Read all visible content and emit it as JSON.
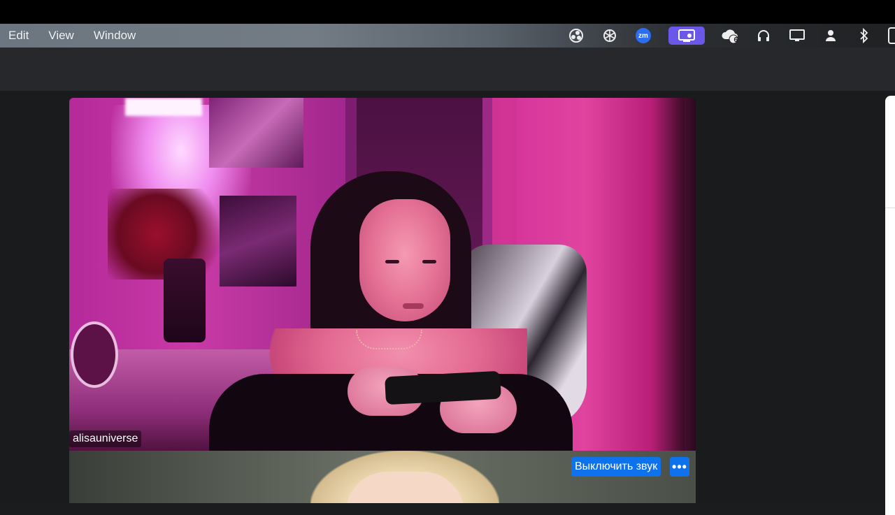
{
  "menubar": {
    "items": [
      {
        "label": "Edit"
      },
      {
        "label": "View"
      },
      {
        "label": "Window"
      }
    ],
    "status_icons": [
      {
        "name": "obs-icon"
      },
      {
        "name": "chatgpt-icon"
      },
      {
        "name": "zoom-icon",
        "text": "zm"
      },
      {
        "name": "screen-share-icon",
        "active": true
      },
      {
        "name": "cloud-sync-icon",
        "badge": "6"
      },
      {
        "name": "headphones-icon"
      },
      {
        "name": "display-icon"
      },
      {
        "name": "user-icon"
      },
      {
        "name": "bluetooth-icon"
      }
    ],
    "colors": {
      "active_icon_bg": "#6c58e8",
      "zoom_blue": "#2d6df0"
    }
  },
  "meeting": {
    "participants": [
      {
        "name": "alisauniverse"
      }
    ],
    "controls": {
      "mute_label": "Выключить звук",
      "more_label": "•••"
    },
    "colors": {
      "button_blue": "#0e72ed"
    }
  }
}
